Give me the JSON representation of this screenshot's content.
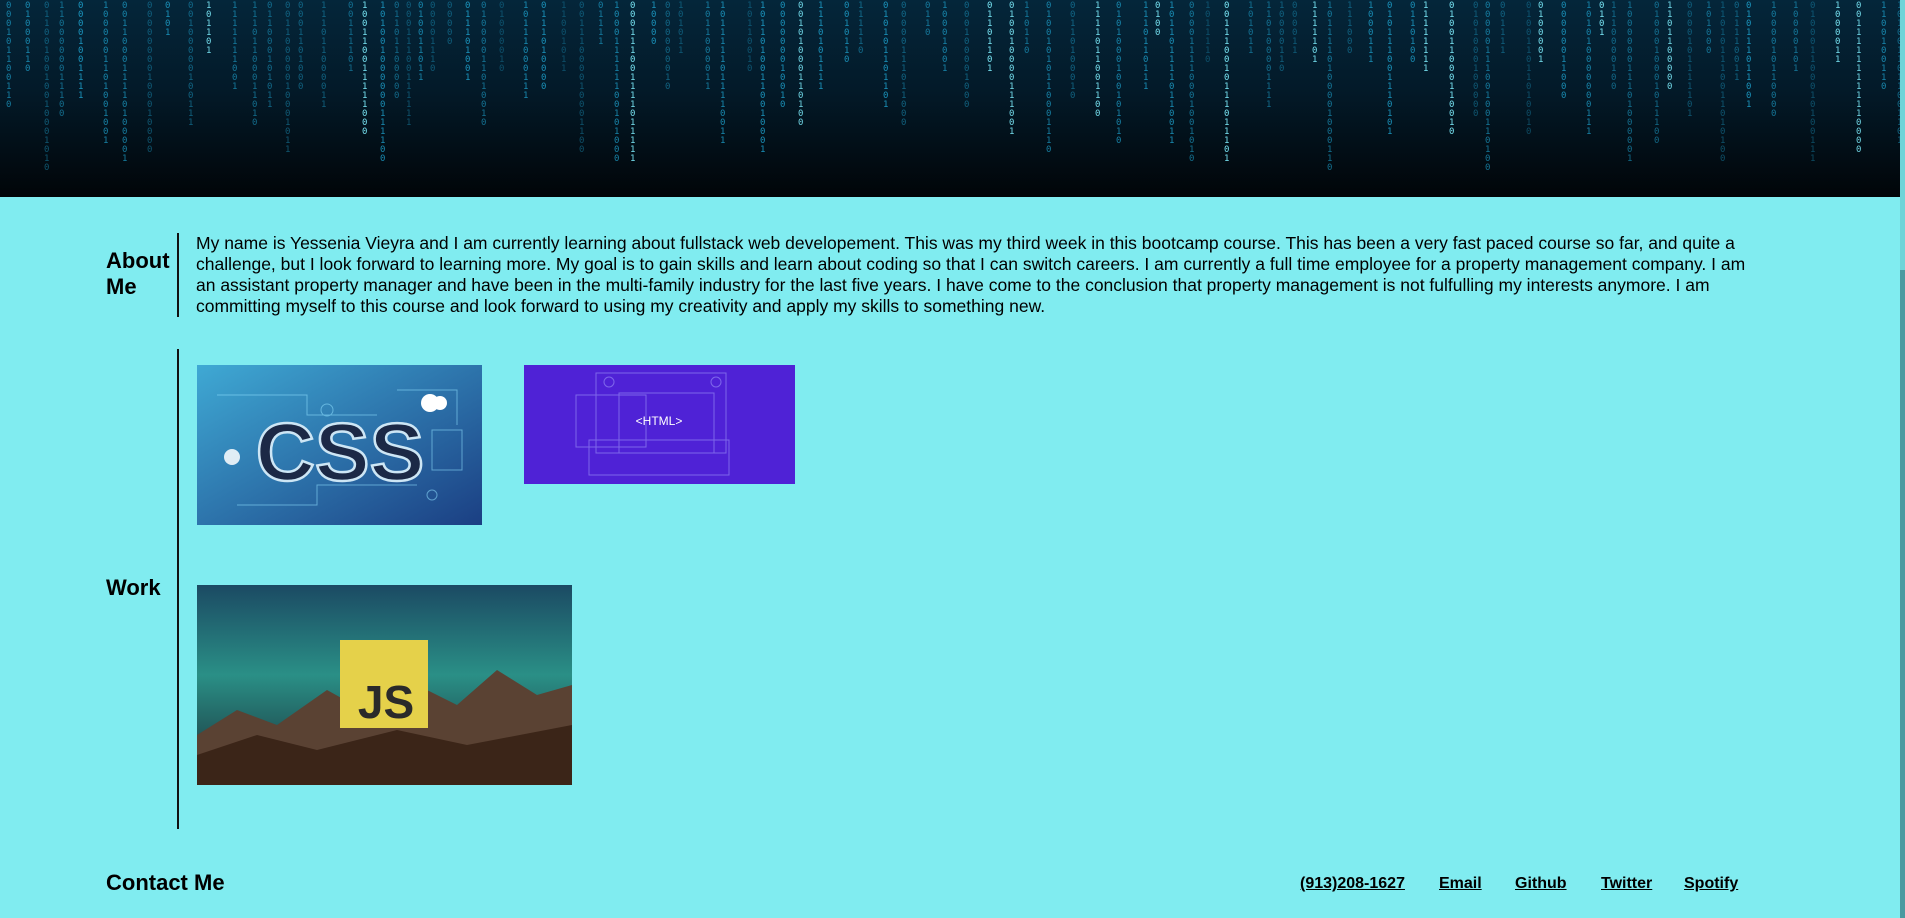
{
  "hero": {
    "image": "binary-code-rain"
  },
  "about": {
    "heading": "About Me",
    "text": "My name is Yessenia Vieyra and I am currently learning about fullstack web developement. This was my third week in this bootcamp course. This has been a very fast paced course so far, and quite a challenge, but I look forward to learning more. My goal is to gain skills and learn about coding so that I can switch careers. I am currently a full time employee for a property management company. I am an assistant property manager and have been in the multi-family industry for the last five years. I have come to the conclusion that property management is not fulfulling my interests anymore. I am committing myself to this course and look forward to using my creativity and apply my skills to something new."
  },
  "work": {
    "heading": "Work",
    "items": [
      {
        "name": "css",
        "label": "CSS"
      },
      {
        "name": "html",
        "label": "<HTML>"
      },
      {
        "name": "javascript",
        "label": "JS"
      }
    ]
  },
  "contact": {
    "heading": "Contact Me",
    "links": [
      {
        "label": "(913)208-1627"
      },
      {
        "label": "Email"
      },
      {
        "label": "Github"
      },
      {
        "label": "Twitter"
      },
      {
        "label": "Spotify"
      }
    ]
  },
  "colors": {
    "background": "#80ecf0",
    "hero_dark": "#031a29",
    "hero_glow": "#2fd6ff",
    "html_tile": "#4f22d6",
    "js_yellow": "#e5d14a"
  }
}
